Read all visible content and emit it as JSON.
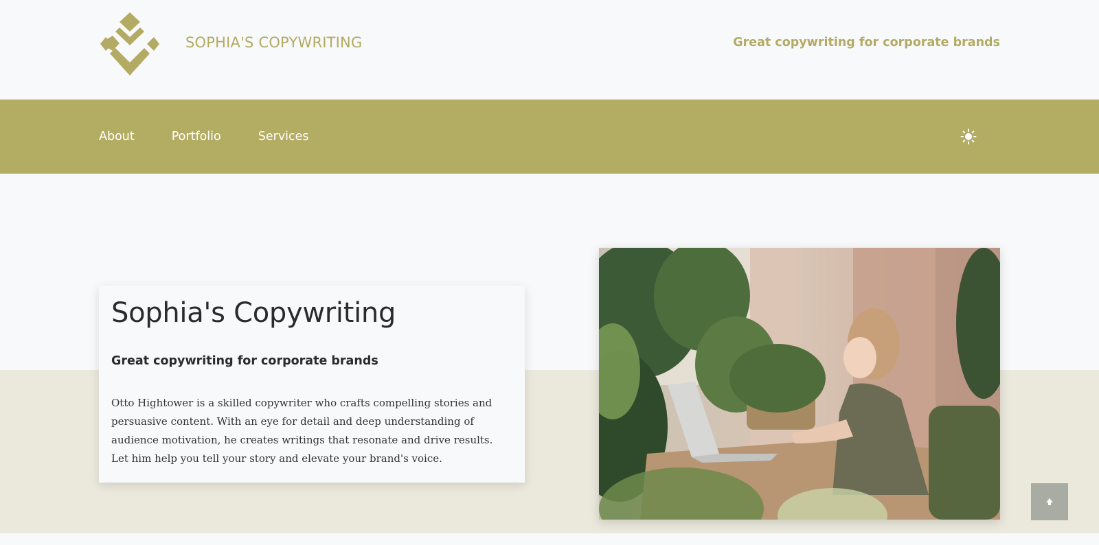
{
  "header": {
    "logo_icon": "diamond-pattern-logo",
    "site_title": "SOPHIA'S COPYWRITING",
    "tagline": "Great copywriting for corporate brands"
  },
  "nav": {
    "items": [
      {
        "label": "About"
      },
      {
        "label": "Portfolio"
      },
      {
        "label": "Services"
      }
    ],
    "theme_toggle_icon": "sun-icon"
  },
  "hero": {
    "title": "Sophia's Copywriting",
    "subtitle": "Great copywriting for corporate brands",
    "body": "Otto Hightower is a skilled copywriter who crafts compelling stories and persuasive content. With an eye for detail and deep understanding of audience motivation, he creates writings that resonate and drive results. Let him help you tell your story and elevate your brand's voice.",
    "photo_icon": "woman-writing-among-plants-photo"
  },
  "back_to_top_icon": "arrow-up-icon",
  "colors": {
    "accent": "#b3ab63",
    "nav_background": "#b3ad63",
    "band_background": "#ebe9dc",
    "page_background": "#f8f9fa",
    "back_to_top_background": "#a8aca3"
  }
}
